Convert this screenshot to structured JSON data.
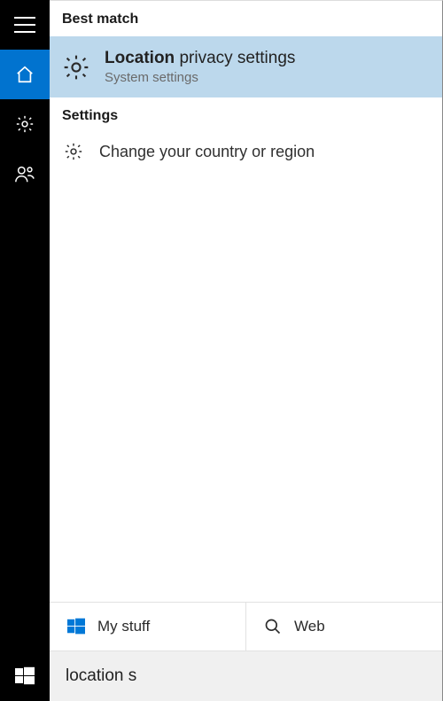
{
  "sidebar": {
    "items": [
      {
        "name": "menu"
      },
      {
        "name": "home",
        "selected": true
      },
      {
        "name": "settings"
      },
      {
        "name": "people"
      }
    ]
  },
  "headers": {
    "best_match": "Best match",
    "settings": "Settings"
  },
  "best_result": {
    "title_bold": "Location",
    "title_rest": " privacy settings",
    "subtitle": "System settings"
  },
  "settings_results": [
    {
      "label": "Change your country or region"
    }
  ],
  "filters": {
    "mystuff": "My stuff",
    "web": "Web"
  },
  "search": {
    "value": "location s",
    "placeholder": ""
  }
}
